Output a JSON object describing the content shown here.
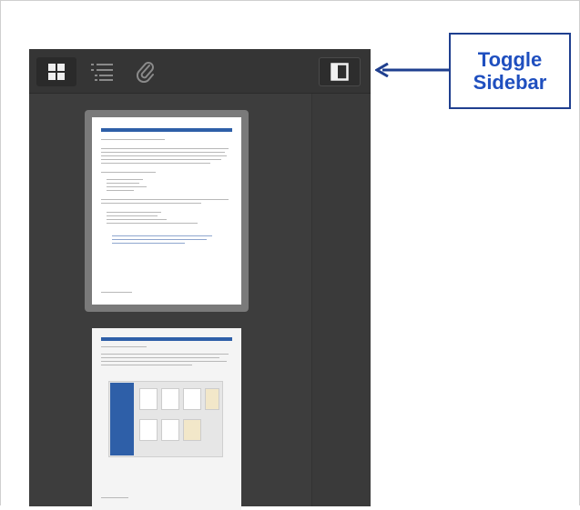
{
  "toolbar": {
    "buttons": [
      {
        "icon": "grid-icon",
        "state": "active"
      },
      {
        "icon": "list-icon",
        "state": "normal"
      },
      {
        "icon": "paperclip-icon",
        "state": "normal"
      }
    ],
    "toggle_sidebar_icon": "sidebar-toggle-icon"
  },
  "callout": {
    "line1": "Toggle",
    "line2": "Sidebar",
    "color": "#1f4fbf"
  },
  "colors": {
    "viewer_bg": "#3b3b3b",
    "toolbar_bg": "#353535",
    "selected_thumb": "#7a7a7a",
    "accent_blue": "#2e5fa8"
  }
}
